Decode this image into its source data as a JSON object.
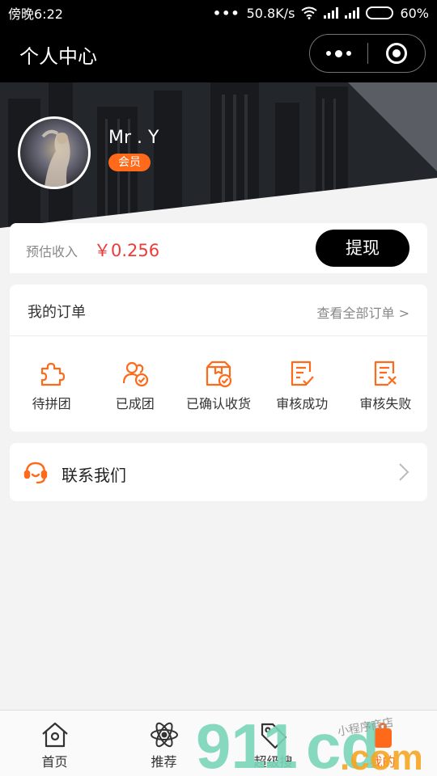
{
  "status_bar": {
    "time": "傍晚6:22",
    "network_speed": "50.8K/s",
    "battery_text": "60%",
    "battery_level": 0.6
  },
  "nav": {
    "title": "个人中心"
  },
  "profile": {
    "username": "Mr . Y",
    "badge": "会员"
  },
  "earnings": {
    "label": "预估收入",
    "value": "￥0.256",
    "withdraw_label": "提现"
  },
  "orders": {
    "title": "我的订单",
    "view_all": "查看全部订单 >",
    "items": [
      {
        "label": "待拼团",
        "icon": "puzzle-icon"
      },
      {
        "label": "已成团",
        "icon": "group-check-icon"
      },
      {
        "label": "已确认收货",
        "icon": "package-check-icon"
      },
      {
        "label": "审核成功",
        "icon": "doc-check-icon"
      },
      {
        "label": "审核失败",
        "icon": "doc-fail-icon"
      }
    ]
  },
  "contact": {
    "label": "联系我们",
    "icon": "headset-icon"
  },
  "tab_bar": {
    "tabs": [
      {
        "label": "首页",
        "icon": "home-icon"
      },
      {
        "label": "推荐",
        "icon": "atom-icon"
      },
      {
        "label": "超级搜",
        "icon": "tag-icon"
      },
      {
        "label": "我的",
        "icon": "profile-icon",
        "active": true
      }
    ]
  },
  "watermark": {
    "logo_text": "911cd.com",
    "tagline": "小程序商店"
  },
  "colors": {
    "accent": "#ff6a1a",
    "price": "#ef3a3a",
    "nav_bg": "#000000",
    "page_bg": "#f3f3f3"
  }
}
